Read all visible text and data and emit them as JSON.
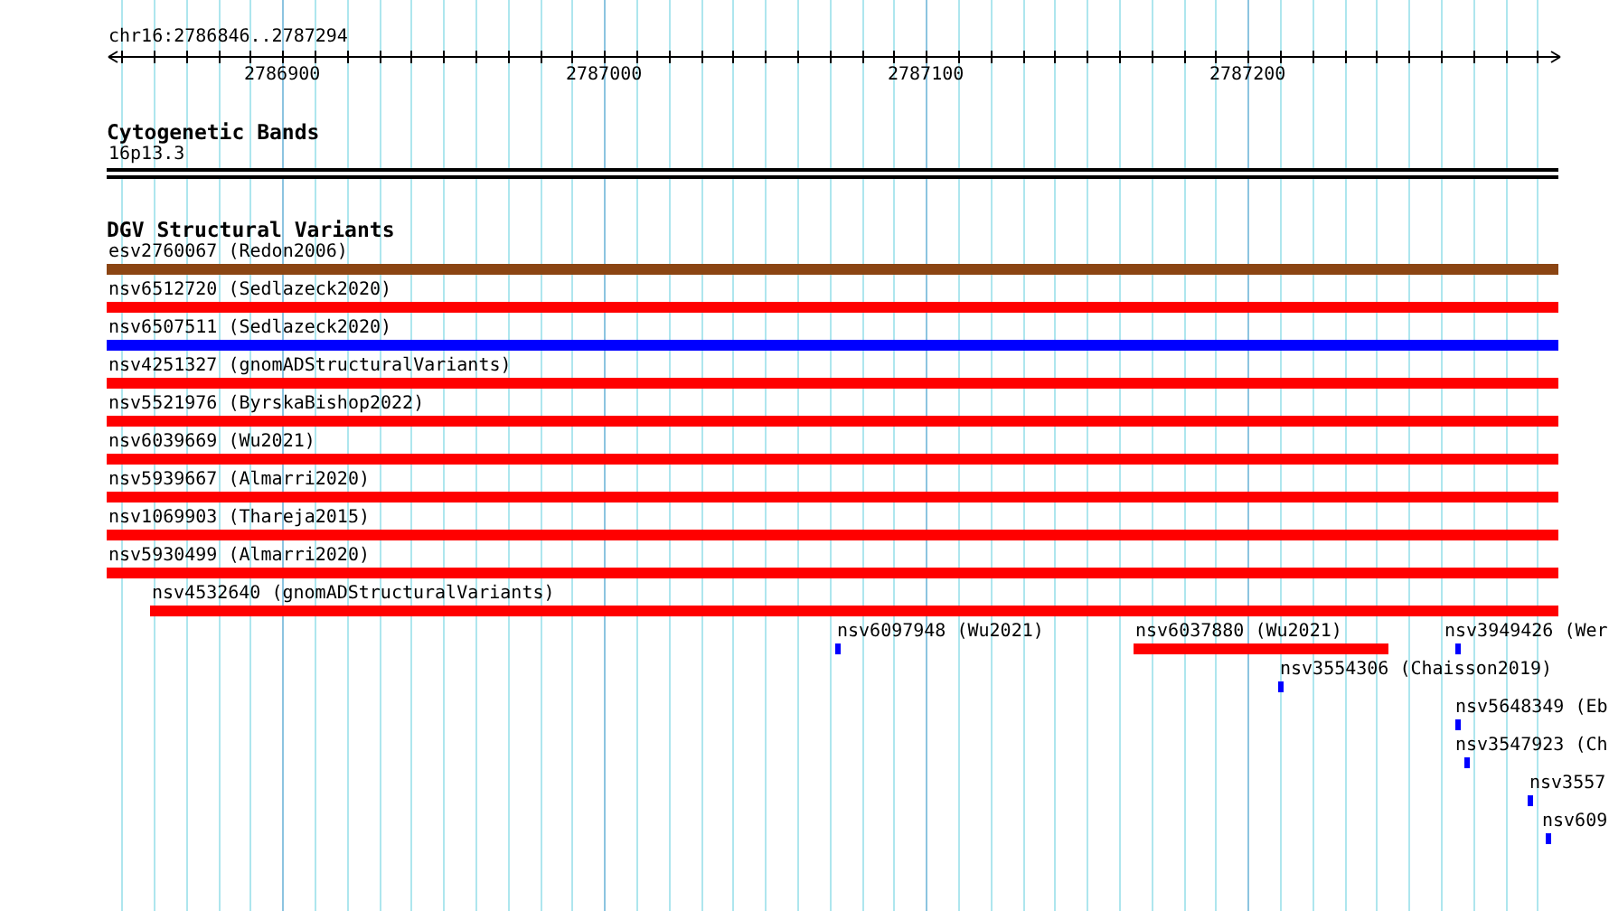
{
  "ruler": {
    "position": "chr16:2786846..2787294",
    "tick_labels": [
      "2786900",
      "2787000",
      "2787100",
      "2787200"
    ]
  },
  "tracks": [
    {
      "kind": "cytoband",
      "title": "Cytogenetic Bands",
      "items": [
        {
          "label": "16p13.3"
        }
      ]
    },
    {
      "kind": "variants",
      "title": "DGV Structural Variants",
      "items": [
        {
          "label": "esv2760067 (Redon2006)",
          "color": "#8b4513"
        },
        {
          "label": "nsv6512720 (Sedlazeck2020)",
          "color": "#ff0000"
        },
        {
          "label": "nsv6507511 (Sedlazeck2020)",
          "color": "#0000ff"
        },
        {
          "label": "nsv4251327 (gnomADStructuralVariants)",
          "color": "#ff0000"
        },
        {
          "label": "nsv5521976 (ByrskaBishop2022)",
          "color": "#ff0000"
        },
        {
          "label": "nsv6039669 (Wu2021)",
          "color": "#ff0000"
        },
        {
          "label": "nsv5939667 (Almarri2020)",
          "color": "#ff0000"
        },
        {
          "label": "nsv1069903 (Thareja2015)",
          "color": "#ff0000"
        },
        {
          "label": "nsv5930499 (Almarri2020)",
          "color": "#ff0000"
        },
        {
          "label": "nsv4532640 (gnomADStructuralVariants)",
          "color": "#ff0000"
        },
        {
          "label": "nsv6097948 (Wu2021)",
          "color": "#0000ff"
        },
        {
          "label": "nsv6037880 (Wu2021)",
          "color": "#ff0000"
        },
        {
          "label": "nsv3949426 (Wer",
          "color": "#0000ff"
        },
        {
          "label": "nsv3554306 (Chaisson2019)",
          "color": "#0000ff"
        },
        {
          "label": "nsv5648349 (Eb",
          "color": "#0000ff"
        },
        {
          "label": "nsv3547923 (Ch",
          "color": "#0000ff"
        },
        {
          "label": "nsv3557",
          "color": "#0000ff"
        },
        {
          "label": "nsv609",
          "color": "#0000ff"
        }
      ]
    }
  ]
}
